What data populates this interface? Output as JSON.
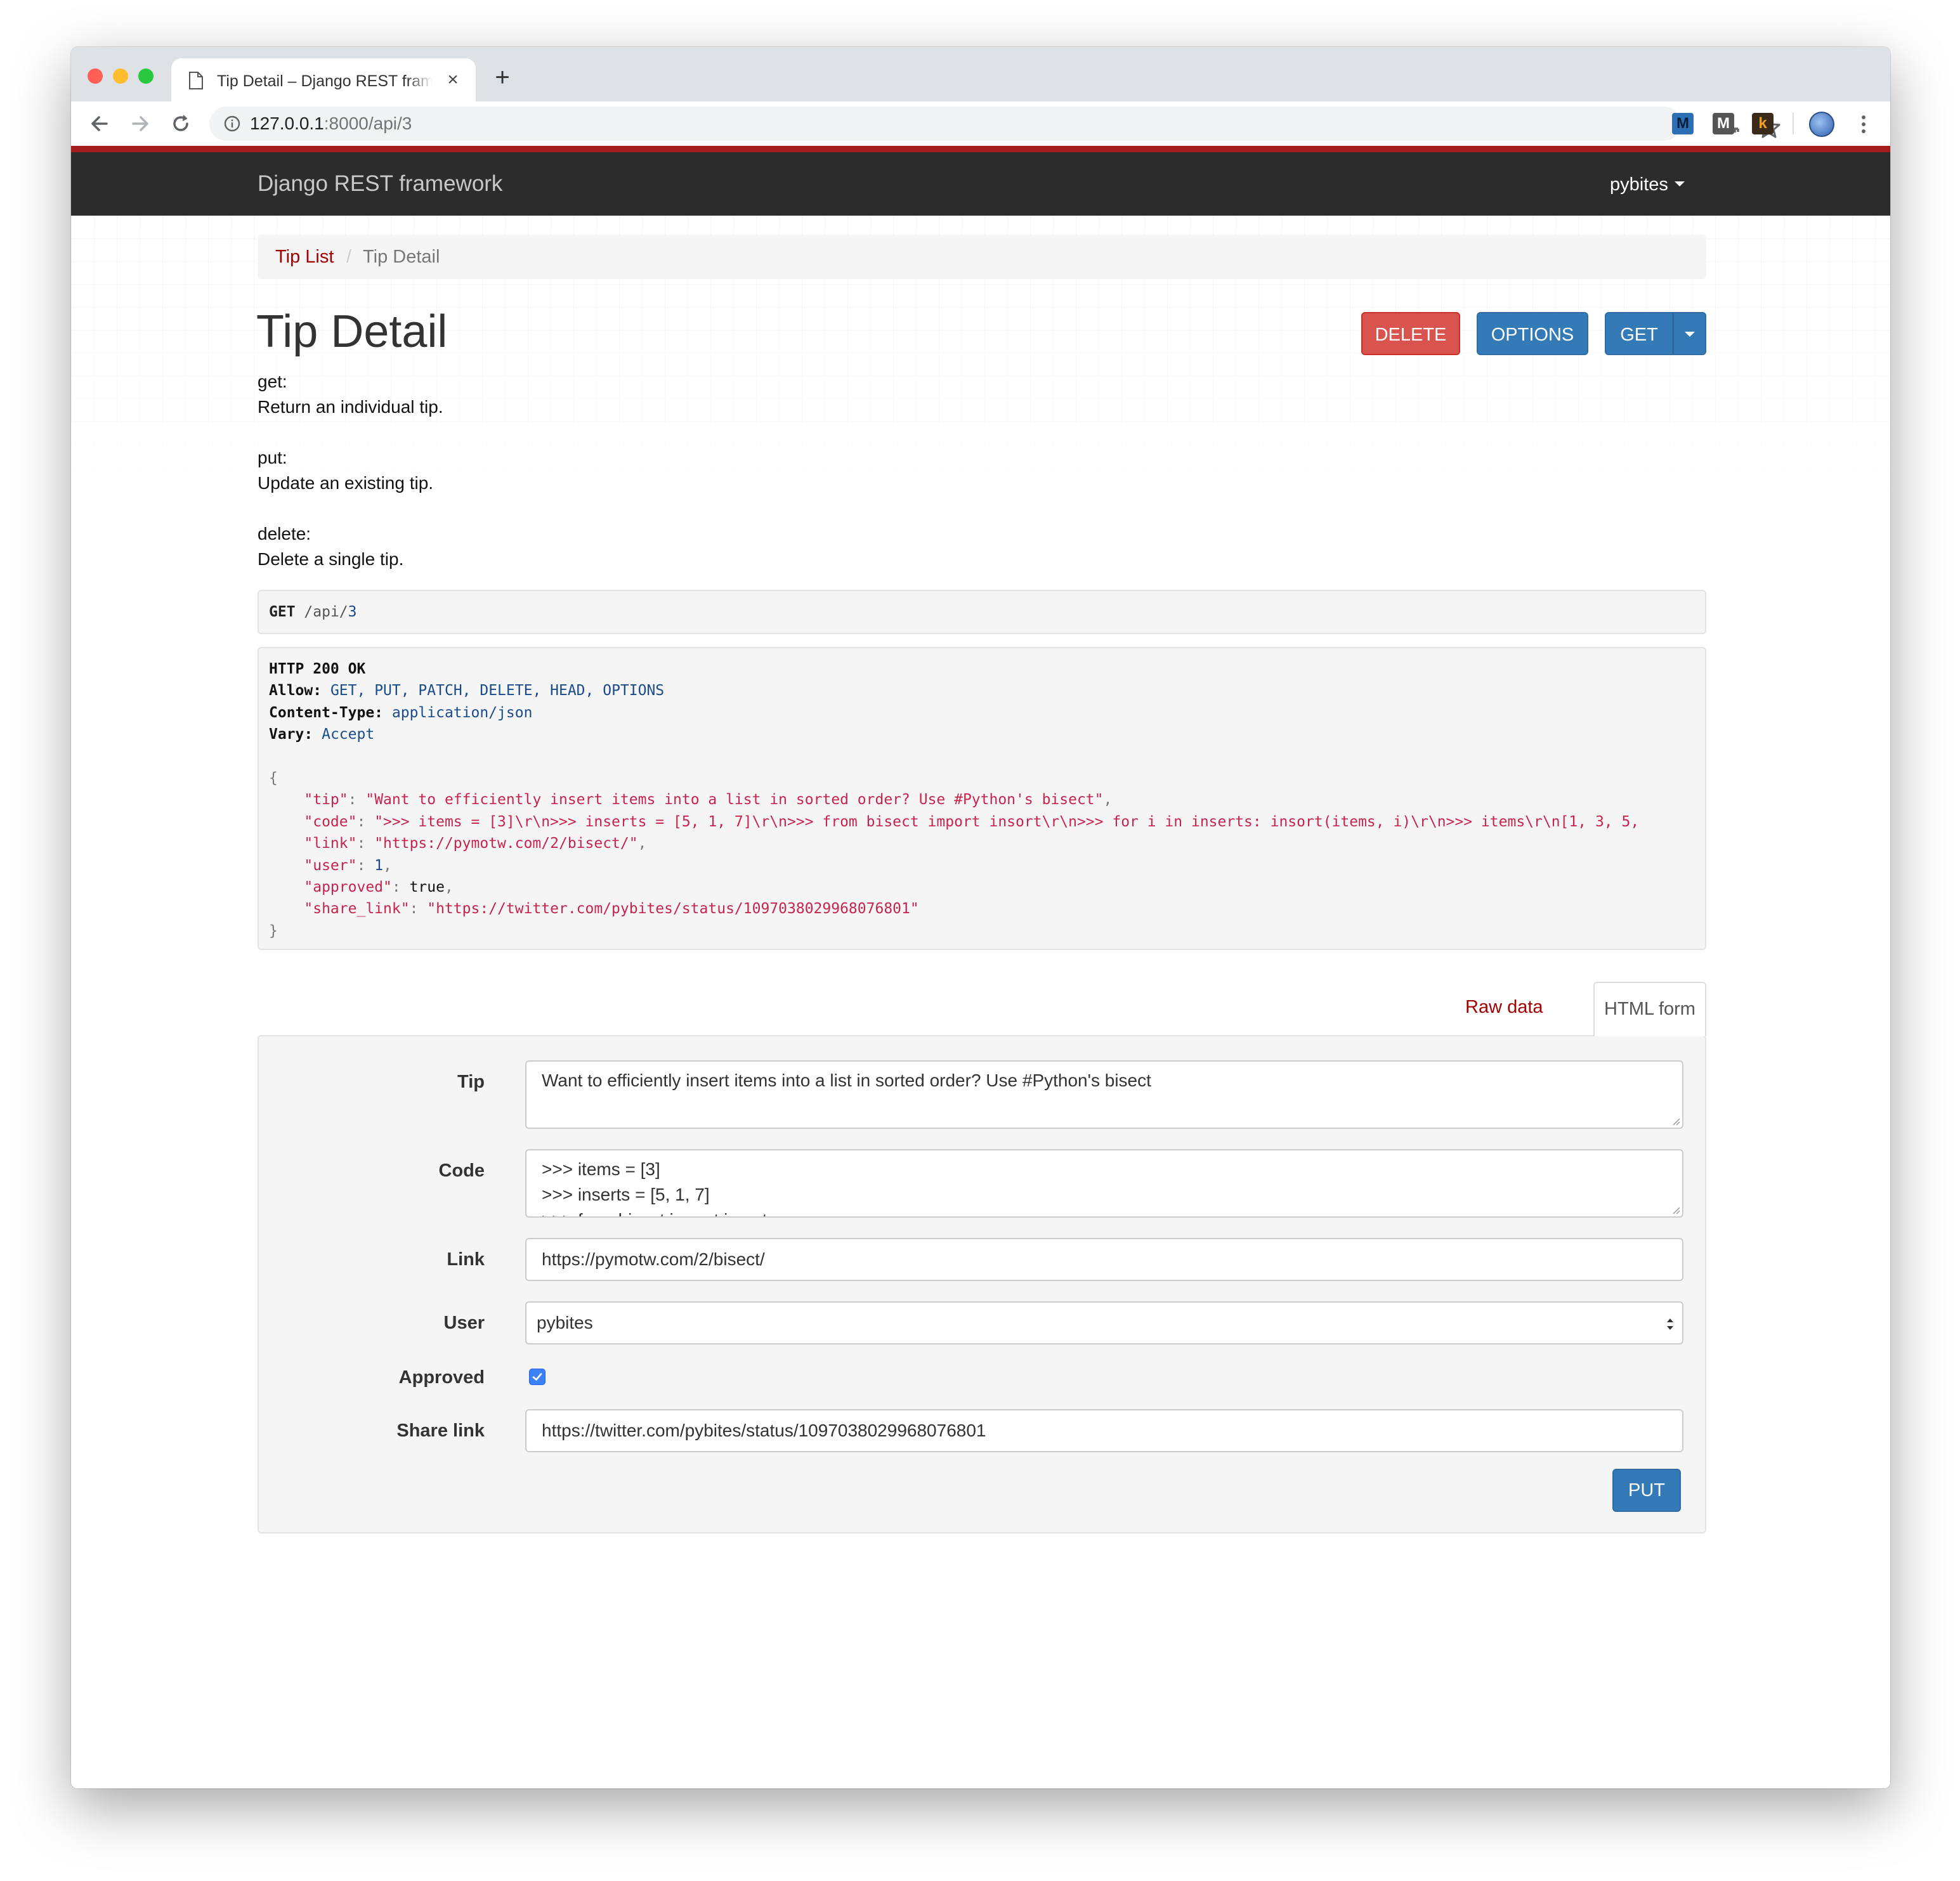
{
  "browser": {
    "tab_title": "Tip Detail – Django REST framework",
    "url_host": "127.0.0.1",
    "url_rest": ":8000/api/3",
    "extensions": [
      "M",
      "M",
      "k"
    ]
  },
  "navbar": {
    "brand": "Django REST framework",
    "user": "pybites"
  },
  "breadcrumb": {
    "link": "Tip List",
    "separator": "/",
    "active": "Tip Detail"
  },
  "page": {
    "title": "Tip Detail",
    "buttons": {
      "delete": "DELETE",
      "options": "OPTIONS",
      "get": "GET"
    },
    "description": [
      {
        "method": "get:",
        "text": "Return an individual tip."
      },
      {
        "method": "put:",
        "text": "Update an existing tip."
      },
      {
        "method": "delete:",
        "text": "Delete a single tip."
      }
    ]
  },
  "request": {
    "method": "GET",
    "path": "/api/",
    "id": "3"
  },
  "response": {
    "status": "HTTP 200 OK",
    "headers": [
      {
        "name": "Allow:",
        "value": "GET, PUT, PATCH, DELETE, HEAD, OPTIONS"
      },
      {
        "name": "Content-Type:",
        "value": "application/json"
      },
      {
        "name": "Vary:",
        "value": "Accept"
      }
    ],
    "open_brace": "{",
    "close_brace": "}",
    "body": [
      {
        "key": "\"tip\"",
        "value": "\"Want to efficiently insert items into a list in sorted order? Use #Python's bisect\"",
        "type": "string"
      },
      {
        "key": "\"code\"",
        "value": "\">>> items = [3]\\r\\n>>> inserts = [5, 1, 7]\\r\\n>>> from bisect import insort\\r\\n>>> for i in inserts: insort(items, i)\\r\\n>>> items\\r\\n[1, 3, 5,",
        "type": "string"
      },
      {
        "key": "\"link\"",
        "value": "\"https://pymotw.com/2/bisect/\"",
        "type": "string"
      },
      {
        "key": "\"user\"",
        "value": "1",
        "type": "number"
      },
      {
        "key": "\"approved\"",
        "value": "true",
        "type": "literal"
      },
      {
        "key": "\"share_link\"",
        "value": "\"https://twitter.com/pybites/status/1097038029968076801\"",
        "type": "string"
      }
    ]
  },
  "form_tabs": {
    "raw": "Raw data",
    "html": "HTML form"
  },
  "form": {
    "tip_label": "Tip",
    "tip_value": "Want to efficiently insert items into a list in sorted order? Use #Python's bisect",
    "code_label": "Code",
    "code_lines": [
      ">>> items = [3]",
      ">>> inserts = [5, 1, 7]",
      ">>> from bisect import insort"
    ],
    "link_label": "Link",
    "link_value": "https://pymotw.com/2/bisect/",
    "user_label": "User",
    "user_value": "pybites",
    "approved_label": "Approved",
    "approved_checked": true,
    "share_label": "Share link",
    "share_value": "https://twitter.com/pybites/status/1097038029968076801",
    "submit": "PUT"
  },
  "colors": {
    "brand_red": "#a30000",
    "danger": "#d9534f",
    "primary": "#337ab7",
    "navbar": "#2c2c2c"
  }
}
